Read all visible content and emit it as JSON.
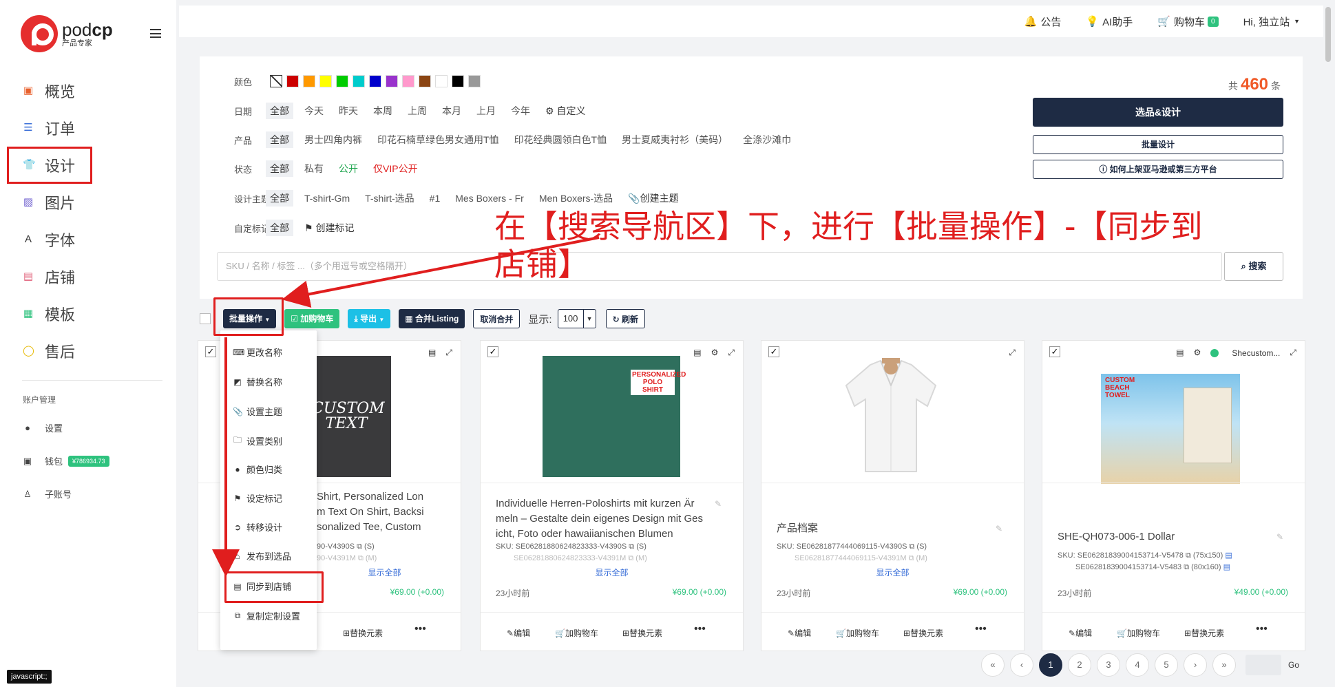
{
  "brand": {
    "name_light": "pod",
    "name_bold": "cp",
    "subtitle": "产品专家"
  },
  "sidebar": {
    "items": [
      {
        "label": "概览",
        "icon": "monitor-icon"
      },
      {
        "label": "订单",
        "icon": "list-icon"
      },
      {
        "label": "设计",
        "icon": "tshirt-icon",
        "active": true
      },
      {
        "label": "图片",
        "icon": "image-icon"
      },
      {
        "label": "字体",
        "icon": "font-icon"
      },
      {
        "label": "店铺",
        "icon": "store-icon"
      },
      {
        "label": "模板",
        "icon": "template-icon"
      },
      {
        "label": "售后",
        "icon": "chat-icon"
      }
    ],
    "account_title": "账户管理",
    "account": [
      {
        "label": "设置",
        "icon": "user-icon"
      },
      {
        "label": "钱包",
        "icon": "wallet-icon",
        "badge": "¥786934.73"
      },
      {
        "label": "子账号",
        "icon": "subaccount-icon"
      }
    ]
  },
  "status_tip": "javascript:;",
  "topbar": {
    "notice": "公告",
    "ai": "AI助手",
    "cart": "购物车",
    "cart_count": "0",
    "user": "Hi, 独立站"
  },
  "filters": {
    "color_label": "颜色",
    "colors": [
      "#cc0000",
      "#ff9900",
      "#ffff00",
      "#00cc00",
      "#00cccc",
      "#0000cc",
      "#9933cc",
      "#ff99cc",
      "#8b4513",
      "#ffffff",
      "#000000",
      "#999999"
    ],
    "date_label": "日期",
    "dates": [
      "全部",
      "今天",
      "昨天",
      "本周",
      "上周",
      "本月",
      "上月",
      "今年"
    ],
    "date_custom": "自定义",
    "product_label": "产品",
    "products": [
      "全部",
      "男士四角内裤",
      "印花石楠草绿色男女通用T恤",
      "印花经典圆领白色T恤",
      "男士夏威夷衬衫（美码）",
      "全涤沙滩巾"
    ],
    "status_label": "状态",
    "statuses": [
      "全部",
      "私有",
      "公开",
      "仅VIP公开"
    ],
    "theme_label": "设计主题",
    "themes": [
      "全部",
      "T-shirt-Gm",
      "T-shirt-选品",
      "#1",
      "Mes Boxers - Fr",
      "Men Boxers-选品"
    ],
    "theme_create": "创建主题",
    "mark_label": "自定标记",
    "marks": [
      "全部"
    ],
    "mark_create": "创建标记"
  },
  "summary": {
    "prefix": "共",
    "total": "460",
    "suffix": "条"
  },
  "buttons": {
    "select_design": "选品&设计",
    "batch_design": "批量设计",
    "how_to": "如何上架亚马逊或第三方平台",
    "search": "搜索"
  },
  "search": {
    "placeholder": "SKU / 名称 / 标签 ...（多个用逗号或空格隔开）"
  },
  "annotation": "在【搜索导航区】下，进行【批量操作】-【同步到店铺】",
  "toolbar": {
    "batch": "批量操作",
    "add_cart": "加购物车",
    "export": "导出",
    "merge": "合并Listing",
    "unmerge": "取消合并",
    "show_label": "显示:",
    "page_size": "100",
    "refresh": "刷新"
  },
  "dropdown": [
    "更改名称",
    "替换名称",
    "设置主题",
    "设置类别",
    "颜色归类",
    "设定标记",
    "转移设计",
    "发布到选品",
    "同步到店铺",
    "复制定制设置"
  ],
  "cards": [
    {
      "title_lines": [
        "Shirt, Personalized Lon",
        "m Text On Shirt, Backsi",
        "sonalized Tee, Custom"
      ],
      "sku_lines": [
        "90-V4390S",
        "90-V4391M"
      ],
      "sku_sizes": [
        "(S)",
        "(M)"
      ],
      "show_all": "显示全部",
      "time": "2",
      "price": "¥69.00 (+0.00)",
      "actions": [
        "替换元素"
      ],
      "img_text": "CUSTOM TEXT"
    },
    {
      "title_lines": [
        "Individuelle Herren-Poloshirts mit kurzen Är",
        "meln – Gestalte dein eigenes Design mit Ges",
        "icht, Foto oder hawaiianischen Blumen"
      ],
      "sku_label": "SKU:",
      "sku_lines": [
        "SE06281880624823333-V4390S",
        "SE06281880624823333-V4391M"
      ],
      "sku_sizes": [
        "(S)",
        "(M)"
      ],
      "show_all": "显示全部",
      "time": "23小时前",
      "price": "¥69.00 (+0.00)",
      "actions": [
        "编辑",
        "加购物车",
        "替换元素"
      ],
      "img_text": "PERSONALIZED POLO SHIRT"
    },
    {
      "title_lines": [
        "产品档案"
      ],
      "sku_label": "SKU:",
      "sku_lines": [
        "SE06281877444069115-V4390S",
        "SE06281877444069115-V4391M"
      ],
      "sku_sizes": [
        "(S)",
        "(M)"
      ],
      "show_all": "显示全部",
      "time": "23小时前",
      "price": "¥69.00 (+0.00)",
      "actions": [
        "编辑",
        "加购物车",
        "替换元素"
      ]
    },
    {
      "title_lines": [
        "SHE-QH073-006-1 Dollar"
      ],
      "shop": "Shecustom...",
      "sku_label": "SKU:",
      "sku_lines": [
        "SE06281839004153714-V5478",
        "SE06281839004153714-V5483"
      ],
      "sku_sizes": [
        "(75x150)",
        "(80x160)"
      ],
      "time": "23小时前",
      "price": "¥49.00 (+0.00)",
      "actions": [
        "编辑",
        "加购物车",
        "替换元素"
      ],
      "img_text": "CUSTOM BEACH TOWEL"
    }
  ],
  "pagination": {
    "first": "«",
    "prev": "‹",
    "pages": [
      "1",
      "2",
      "3",
      "4",
      "5"
    ],
    "next": "›",
    "last": "»",
    "go": "Go"
  },
  "colors": {
    "accent": "#1e2b44",
    "brand": "#e52e2e",
    "green": "#2ec27e",
    "annot": "#e01e1e"
  }
}
